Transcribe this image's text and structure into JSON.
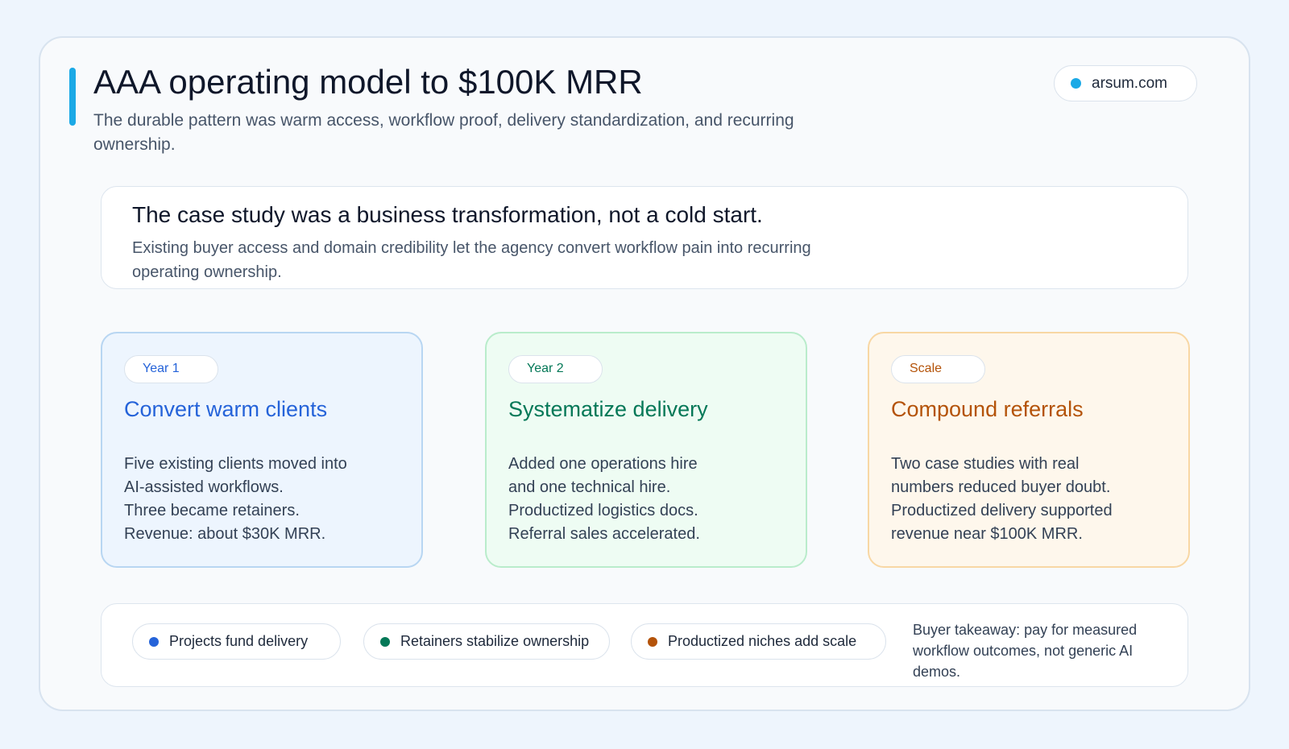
{
  "header": {
    "title": "AAA operating model to $100K MRR",
    "subtitle": "The durable pattern was warm access, workflow proof, delivery standardization, and recurring ownership."
  },
  "site_badge": {
    "label": "arsum.com",
    "dot_color": "#1ba9e6"
  },
  "callout": {
    "title": "The case study was a business transformation, not a cold start.",
    "body": "Existing buyer access and domain credibility let the agency convert workflow pain into recurring operating ownership."
  },
  "cards": [
    {
      "tag": "Year 1",
      "title": "Convert warm clients",
      "lines": [
        "Five existing clients moved into",
        "AI-assisted workflows.",
        "Three became retainers.",
        "Revenue: about $30K MRR."
      ],
      "accent_color": "#2563d9"
    },
    {
      "tag": "Year 2",
      "title": "Systematize delivery",
      "lines": [
        "Added one operations hire",
        "and one technical hire.",
        "Productized logistics docs.",
        "Referral sales accelerated."
      ],
      "accent_color": "#047857"
    },
    {
      "tag": "Scale",
      "title": "Compound referrals",
      "lines": [
        "Two case studies with real",
        "numbers reduced buyer doubt.",
        "Productized delivery supported",
        "revenue near $100K MRR."
      ],
      "accent_color": "#b45309"
    }
  ],
  "footer": {
    "pills": [
      {
        "label": "Projects fund delivery",
        "dot_color": "#2563d9"
      },
      {
        "label": "Retainers stabilize ownership",
        "dot_color": "#047857"
      },
      {
        "label": "Productized niches add scale",
        "dot_color": "#b45309"
      }
    ],
    "takeaway": "Buyer takeaway: pay for measured workflow outcomes, not generic AI demos."
  }
}
